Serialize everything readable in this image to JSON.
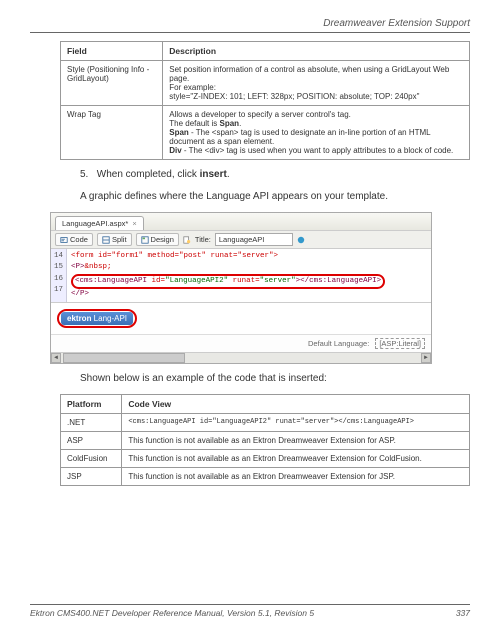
{
  "header": {
    "title": "Dreamweaver Extension Support"
  },
  "table1": {
    "headers": {
      "field": "Field",
      "desc": "Description"
    },
    "rows": [
      {
        "field": "Style (Positioning Info - GridLayout)",
        "desc_l1": "Set position information of a control as absolute, when using a GridLayout Web page.",
        "desc_l2": "For example:",
        "desc_l3": "style=\"Z-INDEX: 101; LEFT: 328px; POSITION: absolute; TOP: 240px\""
      },
      {
        "field": "Wrap Tag",
        "desc_l1": "Allows a developer to specify a server control's tag.",
        "desc_l2a": "The default is ",
        "desc_l2b": "Span",
        "desc_l2c": ".",
        "desc_l3a": "Span",
        "desc_l3b": " - The <span> tag is used to designate an in-line portion of an HTML document as a span element.",
        "desc_l4a": "Div",
        "desc_l4b": " - The <div> tag is used when you want to apply attributes to a block of code."
      }
    ]
  },
  "step": {
    "num": "5.",
    "text_a": "When completed, click ",
    "text_b": "insert",
    "text_c": "."
  },
  "para1": "A graphic defines where the Language API appears on your template.",
  "screenshot": {
    "tab": "LanguageAPI.aspx*",
    "tb_code": "Code",
    "tb_split": "Split",
    "tb_design": "Design",
    "tb_title_label": "Title:",
    "tb_title_value": "LanguageAPI",
    "gutter": [
      "14",
      "15",
      "16",
      "17"
    ],
    "line14": "<form id=\"form1\" method=\"post\" runat=\"server\">",
    "line15": "<P>&nbsp;",
    "line16_full": "<cms:LanguageAPI id=\"LanguageAPI2\" runat=\"server\"></cms:LanguageAPI>",
    "line17": "</P>",
    "badge_bold": "ektron",
    "badge_text": " Lang-API",
    "footer_label": "Default Language:",
    "footer_value": "[ASP:Literal]"
  },
  "para2": "Shown below is an example of the code that is inserted:",
  "table2": {
    "headers": {
      "platform": "Platform",
      "code": "Code View"
    },
    "rows": [
      {
        "platform": ".NET",
        "code": "<cms:LanguageAPI id=\"LanguageAPI2\" runat=\"server\"></cms:LanguageAPI>"
      },
      {
        "platform": "ASP",
        "code": "This function is not available as an Ektron Dreamweaver Extension for ASP."
      },
      {
        "platform": "ColdFusion",
        "code": "This function is not available as an Ektron Dreamweaver Extension for ColdFusion."
      },
      {
        "platform": "JSP",
        "code": "This function is not available as an Ektron Dreamweaver Extension for JSP."
      }
    ]
  },
  "footer": {
    "text": "Ektron CMS400.NET Developer Reference Manual, Version 5.1, Revision 5",
    "page": "337"
  }
}
